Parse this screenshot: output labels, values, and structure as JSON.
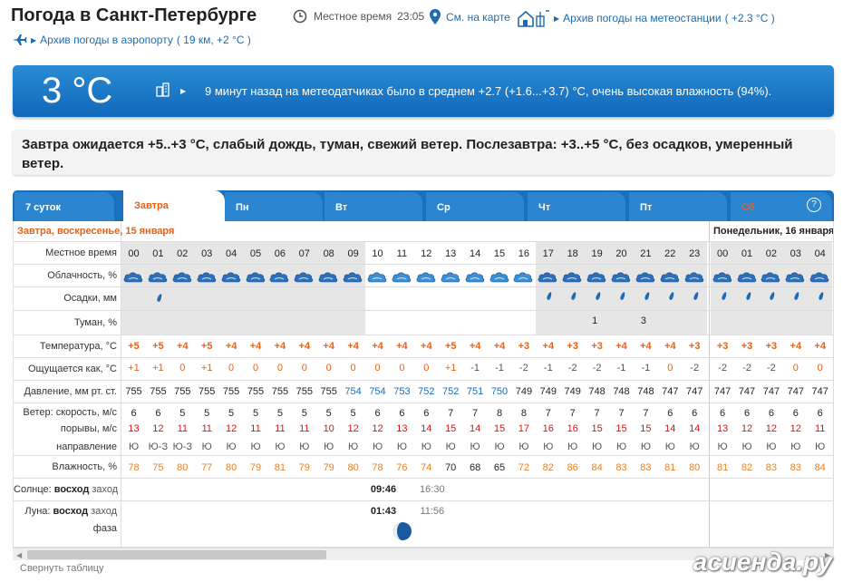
{
  "header": {
    "title": "Погода в Санкт-Петербурге",
    "local_time_label": "Местное время",
    "local_time": "23:05",
    "map_link": "См. на карте",
    "station_archive_link": "Архив погоды на метеостанции",
    "station_archive_temp": "( +2.3 °C )",
    "airport_archive_link": "Архив погоды в аэропорту",
    "airport_archive_info": "( 19 км, +2 °C )"
  },
  "current": {
    "temp": "3 °C",
    "message": "9 минут назад на метеодатчиках было в среднем +2.7 (+1.6...+3.7) °C, очень высокая влажность (94%)."
  },
  "forecast_text": "Завтра ожидается +5..+3 °C, слабый дождь, туман, свежий ветер. Послезавтра: +3..+5 °C, без осадков, умеренный ветер.",
  "tabs": [
    "7 суток",
    "Завтра",
    "Пн",
    "Вт",
    "Ср",
    "Чт",
    "Пт",
    "Сб"
  ],
  "help_label": "?",
  "table": {
    "date1": "Завтра, воскресенье, 15 января",
    "date2": "Понедельник, 16 января",
    "labels": {
      "time": "Местное время",
      "clouds": "Облачность, %",
      "precip": "Осадки, мм",
      "fog": "Туман, %",
      "temp": "Температура, °C",
      "feels": "Ощущается как, °C",
      "pressure": "Давление, мм рт. ст.",
      "wind": "Ветер: скорость, м/с",
      "gusts": "порывы, м/с",
      "direction": "направление",
      "humidity": "Влажность, %",
      "sun_a": "Солнце:",
      "sun_b": "восход",
      "sun_c": "заход",
      "moon_a": "Луна:",
      "moon_b": "восход",
      "moon_c": "заход",
      "phase": "фаза"
    },
    "hours": [
      "00",
      "01",
      "02",
      "03",
      "04",
      "05",
      "06",
      "07",
      "08",
      "09",
      "10",
      "11",
      "12",
      "13",
      "14",
      "15",
      "16",
      "17",
      "18",
      "19",
      "20",
      "21",
      "22",
      "23",
      "00",
      "01",
      "02",
      "03",
      "04"
    ],
    "temp": [
      "+5",
      "+5",
      "+4",
      "+5",
      "+4",
      "+4",
      "+4",
      "+4",
      "+4",
      "+4",
      "+4",
      "+4",
      "+4",
      "+5",
      "+4",
      "+4",
      "+3",
      "+4",
      "+3",
      "+3",
      "+4",
      "+4",
      "+4",
      "+3",
      "+3",
      "+3",
      "+3",
      "+4",
      "+4"
    ],
    "feels": [
      "+1",
      "+1",
      "0",
      "+1",
      "0",
      "0",
      "0",
      "0",
      "0",
      "0",
      "0",
      "0",
      "0",
      "+1",
      "-1",
      "-1",
      "-2",
      "-1",
      "-2",
      "-2",
      "-1",
      "-1",
      "0",
      "-2",
      "-2",
      "-2",
      "-2",
      "0",
      "0"
    ],
    "pressure": [
      "755",
      "755",
      "755",
      "755",
      "755",
      "755",
      "755",
      "755",
      "755",
      "754",
      "754",
      "753",
      "752",
      "752",
      "751",
      "750",
      "749",
      "749",
      "749",
      "748",
      "748",
      "748",
      "747",
      "747",
      "747",
      "747",
      "747",
      "747",
      "747"
    ],
    "wind": [
      "6",
      "6",
      "5",
      "5",
      "5",
      "5",
      "5",
      "5",
      "5",
      "5",
      "6",
      "6",
      "6",
      "7",
      "7",
      "8",
      "8",
      "7",
      "7",
      "7",
      "7",
      "7",
      "6",
      "6",
      "6",
      "6",
      "6",
      "6",
      "6"
    ],
    "gusts": [
      "13",
      "12",
      "11",
      "11",
      "12",
      "11",
      "11",
      "11",
      "10",
      "12",
      "12",
      "13",
      "14",
      "15",
      "14",
      "15",
      "17",
      "16",
      "16",
      "15",
      "15",
      "15",
      "14",
      "14",
      "13",
      "12",
      "12",
      "12",
      "11"
    ],
    "direction": [
      "Ю",
      "Ю-З",
      "Ю-З",
      "Ю",
      "Ю",
      "Ю",
      "Ю",
      "Ю",
      "Ю",
      "Ю",
      "Ю",
      "Ю",
      "Ю",
      "Ю",
      "Ю",
      "Ю",
      "Ю",
      "Ю",
      "Ю",
      "Ю",
      "Ю",
      "Ю",
      "Ю",
      "Ю",
      "Ю",
      "Ю",
      "Ю",
      "Ю",
      "Ю"
    ],
    "humidity": [
      "78",
      "75",
      "80",
      "77",
      "80",
      "79",
      "81",
      "79",
      "79",
      "80",
      "78",
      "76",
      "74",
      "70",
      "68",
      "65",
      "72",
      "82",
      "86",
      "84",
      "83",
      "83",
      "81",
      "80",
      "81",
      "82",
      "83",
      "83",
      "84"
    ],
    "fog_values": [
      {
        "hour": "19",
        "value": "1"
      },
      {
        "hour": "21",
        "value": "3"
      }
    ],
    "sunrise": "09:46",
    "sunset": "16:30",
    "moonrise": "01:43",
    "moonset": "11:56"
  },
  "collapse_link": "Свернуть таблицу",
  "watermark": "асиенда.ру",
  "colors": {
    "warm": "#e86016",
    "banner": "#1a70bb",
    "link": "#1d6bb3",
    "humidity": "#e8822a"
  }
}
